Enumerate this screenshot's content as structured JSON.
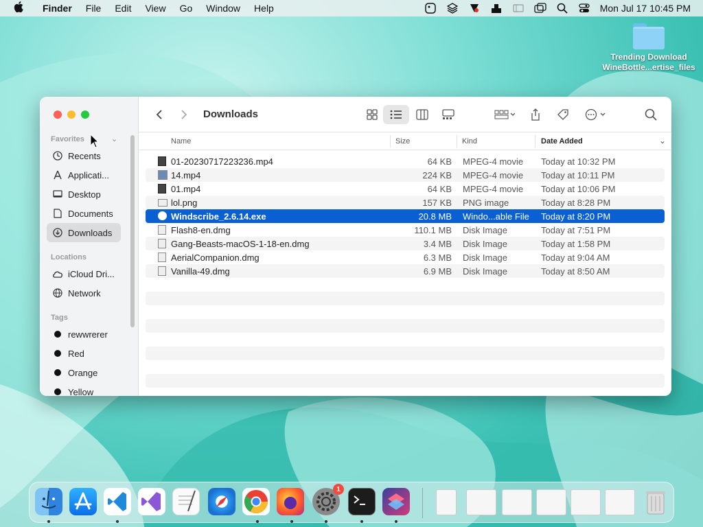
{
  "menubar": {
    "apple": "",
    "app": "Finder",
    "items": [
      "File",
      "Edit",
      "View",
      "Go",
      "Window",
      "Help"
    ],
    "clock": "Mon Jul 17  10:45 PM"
  },
  "desktop": {
    "folder_label_1": "Trending Download",
    "folder_label_2": "WineBottle...ertise_files"
  },
  "window": {
    "title": "Downloads",
    "sidebar": {
      "favorites_label": "Favorites",
      "favorites": [
        "Recents",
        "Applicati...",
        "Desktop",
        "Documents",
        "Downloads"
      ],
      "locations_label": "Locations",
      "locations": [
        "iCloud Dri...",
        "Network"
      ],
      "tags_label": "Tags",
      "tags": [
        {
          "name": "rewwrerer",
          "color": "#111111"
        },
        {
          "name": "Red",
          "color": "#111111"
        },
        {
          "name": "Orange",
          "color": "#111111"
        },
        {
          "name": "Yellow",
          "color": "#111111"
        }
      ]
    },
    "columns": {
      "name": "Name",
      "size": "Size",
      "kind": "Kind",
      "date": "Date Added"
    },
    "files": [
      {
        "name": "01-20230717223236.mp4",
        "size": "64 KB",
        "kind": "MPEG-4 movie",
        "date": "Today at 10:32 PM"
      },
      {
        "name": "14.mp4",
        "size": "224 KB",
        "kind": "MPEG-4 movie",
        "date": "Today at 10:11 PM"
      },
      {
        "name": "01.mp4",
        "size": "64 KB",
        "kind": "MPEG-4 movie",
        "date": "Today at 10:06 PM"
      },
      {
        "name": "lol.png",
        "size": "157 KB",
        "kind": "PNG image",
        "date": "Today at 8:28 PM"
      },
      {
        "name": "Windscribe_2.6.14.exe",
        "size": "20.8 MB",
        "kind": "Windo...able File",
        "date": "Today at 8:20 PM"
      },
      {
        "name": "Flash8-en.dmg",
        "size": "110.1 MB",
        "kind": "Disk Image",
        "date": "Today at 7:51 PM"
      },
      {
        "name": "Gang-Beasts-macOS-1-18-en.dmg",
        "size": "3.4 MB",
        "kind": "Disk Image",
        "date": "Today at 1:58 PM"
      },
      {
        "name": "AerialCompanion.dmg",
        "size": "6.3 MB",
        "kind": "Disk Image",
        "date": "Today at 9:04 AM"
      },
      {
        "name": "Vanilla-49.dmg",
        "size": "6.9 MB",
        "kind": "Disk Image",
        "date": "Today at 8:50 AM"
      }
    ],
    "selected_index": 4
  },
  "dock": {
    "settings_badge": "1"
  },
  "colors": {
    "selection": "#0a5fd3",
    "wallpaper": "#5fd3c7"
  }
}
